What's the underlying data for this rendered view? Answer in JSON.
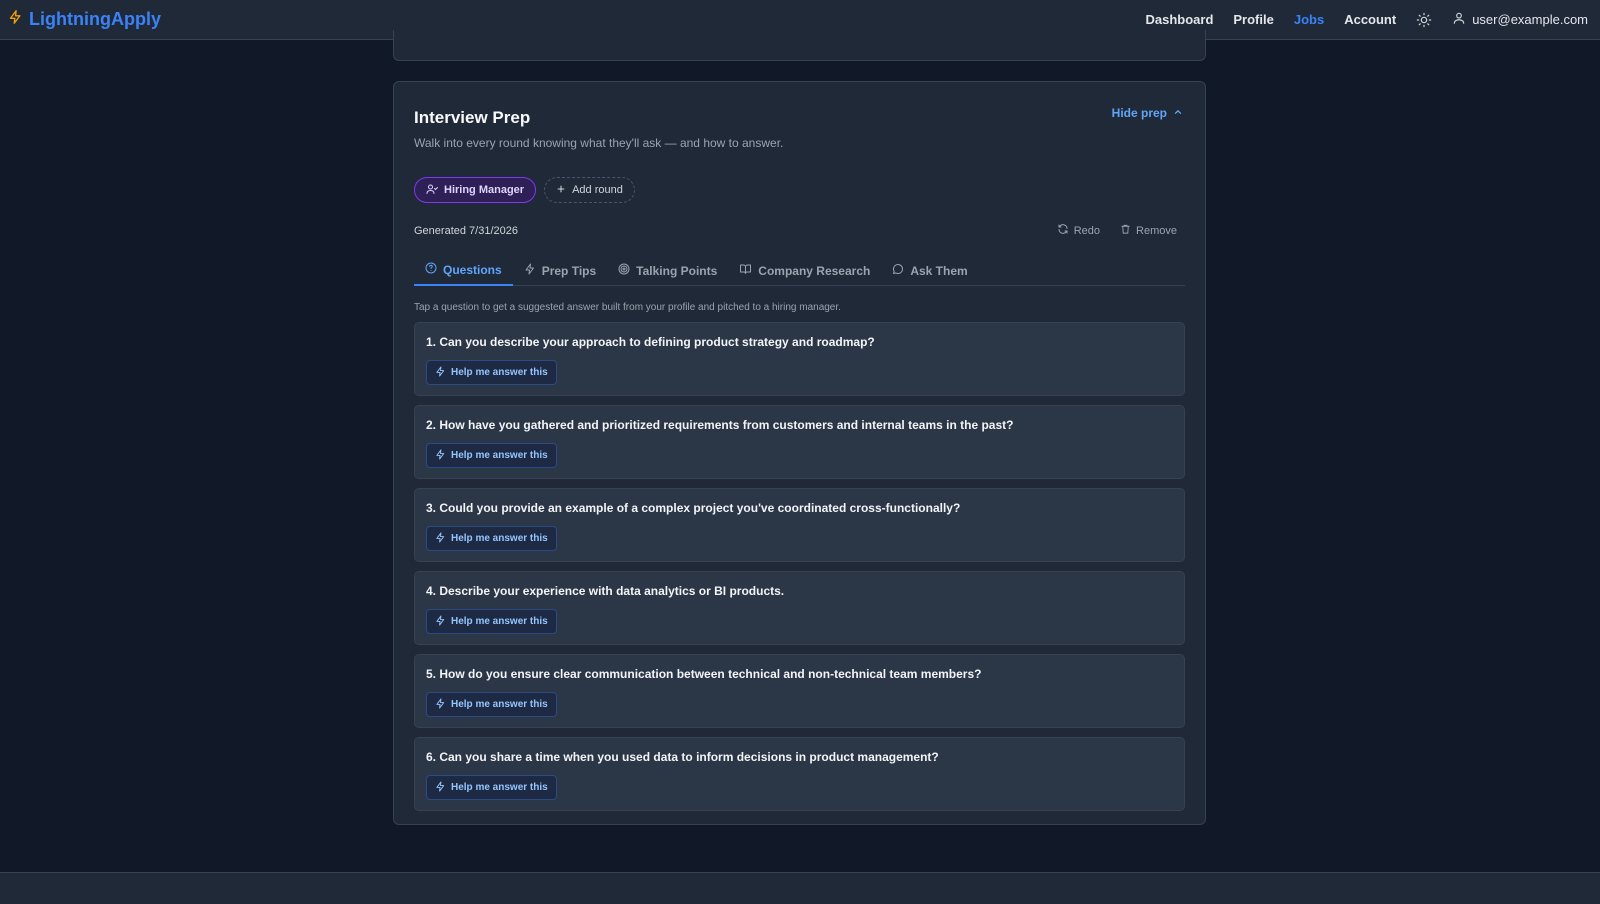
{
  "header": {
    "brand": "LightningApply",
    "nav": [
      "Dashboard",
      "Profile",
      "Jobs",
      "Account"
    ],
    "active_nav": "Jobs",
    "user_email": "user@example.com"
  },
  "prep": {
    "title": "Interview Prep",
    "subtitle": "Walk into every round knowing what they'll ask — and how to answer.",
    "hide_label": "Hide prep",
    "rounds": [
      {
        "label": "Hiring Manager",
        "active": true
      }
    ],
    "add_round_label": "Add round",
    "generated": "Generated 7/31/2026",
    "redo_label": "Redo",
    "remove_label": "Remove",
    "tabs": [
      "Questions",
      "Prep Tips",
      "Talking Points",
      "Company Research",
      "Ask Them"
    ],
    "active_tab": "Questions",
    "hint": "Tap a question to get a suggested answer built from your profile and pitched to a hiring manager.",
    "help_label": "Help me answer this",
    "questions": [
      "1. Can you describe your approach to defining product strategy and roadmap?",
      "2. How have you gathered and prioritized requirements from customers and internal teams in the past?",
      "3. Could you provide an example of a complex project you've coordinated cross-functionally?",
      "4. Describe your experience with data analytics or BI products.",
      "5. How do you ensure clear communication between technical and non-technical team members?",
      "6. Can you share a time when you used data to inform decisions in product management?"
    ]
  },
  "colors": {
    "accent": "#3b82f6",
    "round_chip": "#7c3aed",
    "brand_bolt": "#f59e0b"
  }
}
